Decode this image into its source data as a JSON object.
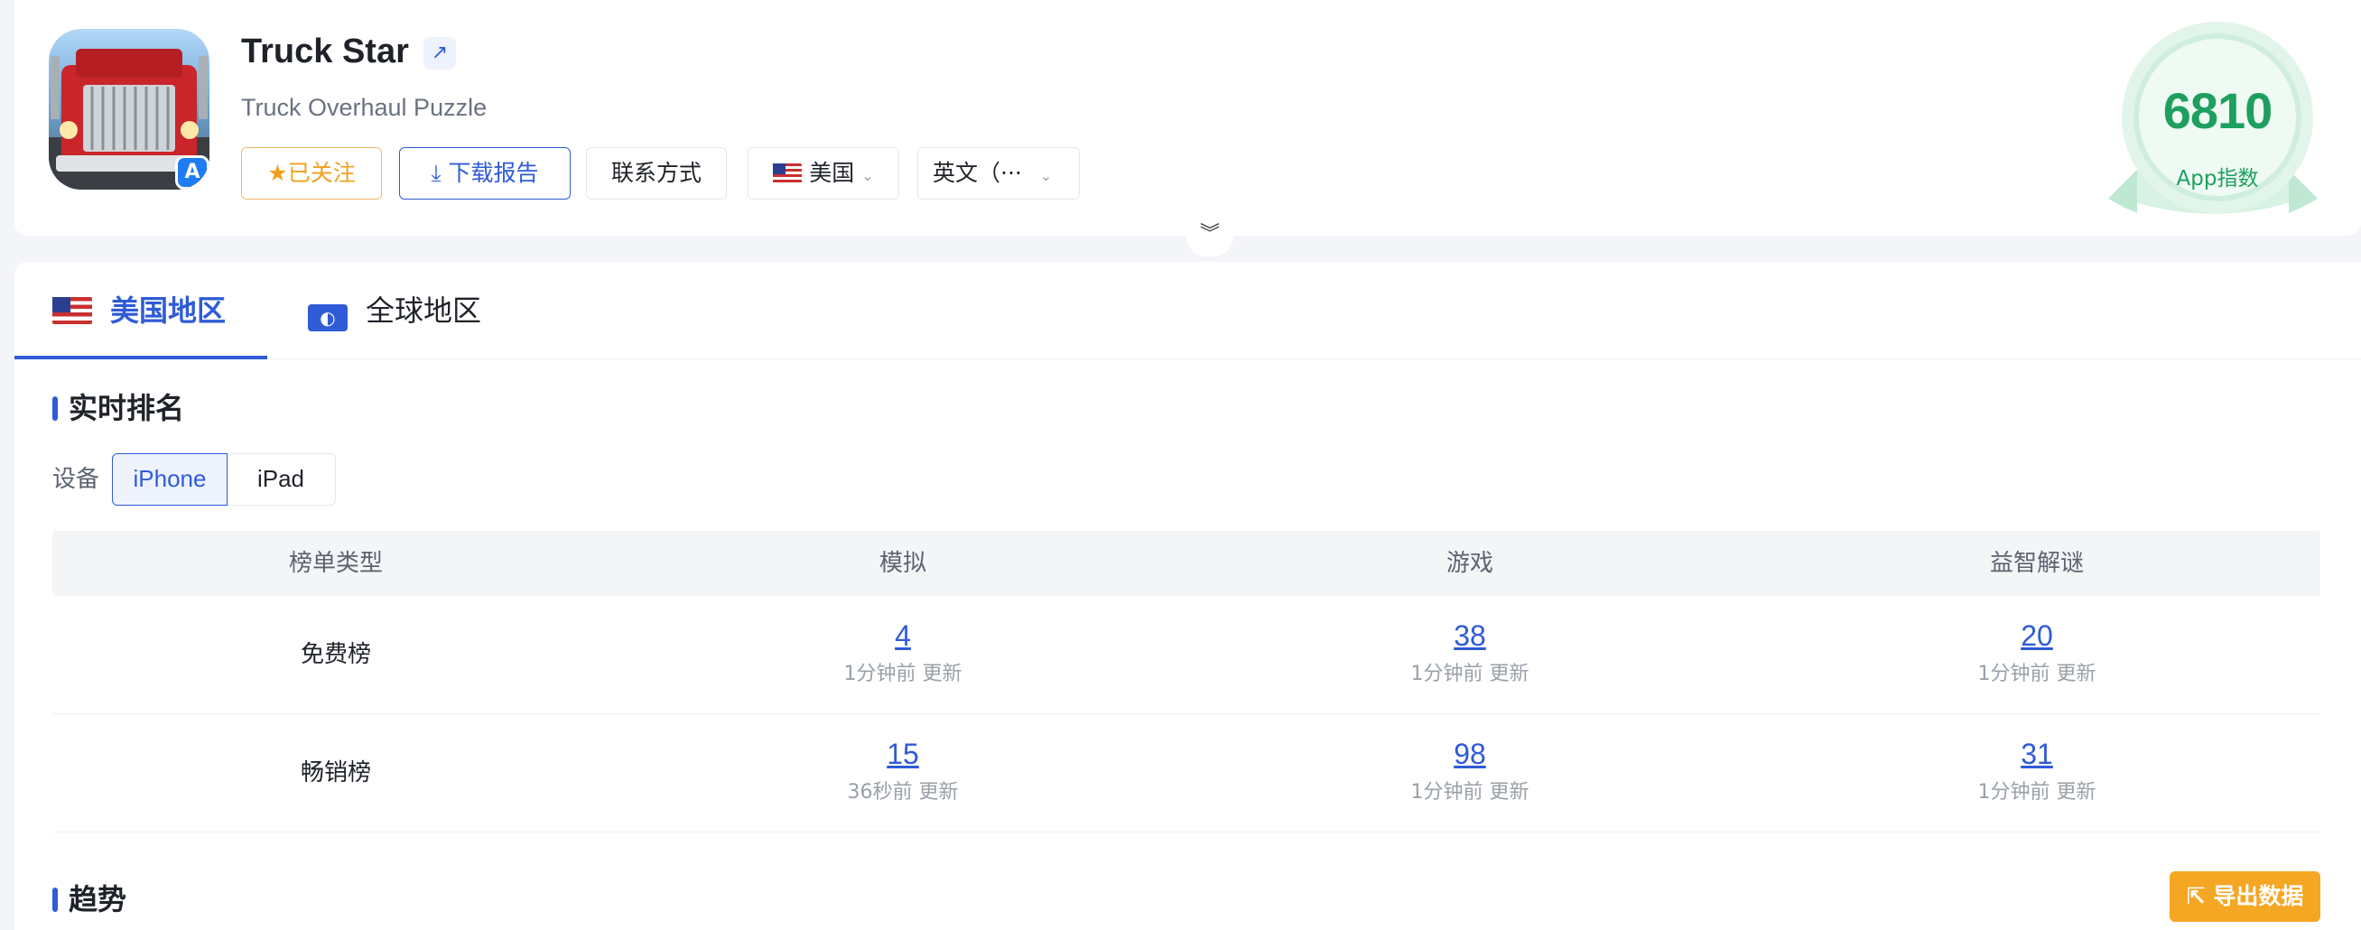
{
  "app": {
    "title": "Truck Star",
    "subtitle": "Truck Overhaul Puzzle",
    "ext_link_icon": "↗",
    "store_badge_glyph": "A"
  },
  "actions": {
    "follow": "已关注",
    "download": "下载报告",
    "contact": "联系方式",
    "country": "美国",
    "language": "英文（···"
  },
  "score": {
    "value": "6810",
    "label": "App指数"
  },
  "tabs": [
    {
      "label": "美国地区",
      "icon": "us-flag-icon"
    },
    {
      "label": "全球地区",
      "icon": "globe-icon"
    }
  ],
  "realtime": {
    "title": "实时排名",
    "device_label": "设备",
    "devices": [
      "iPhone",
      "iPad"
    ],
    "selected_device": "iPhone",
    "columns": [
      "榜单类型",
      "模拟",
      "游戏",
      "益智解谜"
    ],
    "rows": [
      {
        "label": "免费榜",
        "cells": [
          {
            "rank": "4",
            "updated": "1分钟前 更新"
          },
          {
            "rank": "38",
            "updated": "1分钟前 更新"
          },
          {
            "rank": "20",
            "updated": "1分钟前 更新"
          }
        ]
      },
      {
        "label": "畅销榜",
        "cells": [
          {
            "rank": "15",
            "updated": "36秒前 更新"
          },
          {
            "rank": "98",
            "updated": "1分钟前 更新"
          },
          {
            "rank": "31",
            "updated": "1分钟前 更新"
          }
        ]
      }
    ]
  },
  "trend": {
    "title": "趋势",
    "export": "导出数据"
  },
  "colors": {
    "accent": "#2f5bd7",
    "orange": "#f5a623",
    "score_green": "#1e9f5e"
  }
}
